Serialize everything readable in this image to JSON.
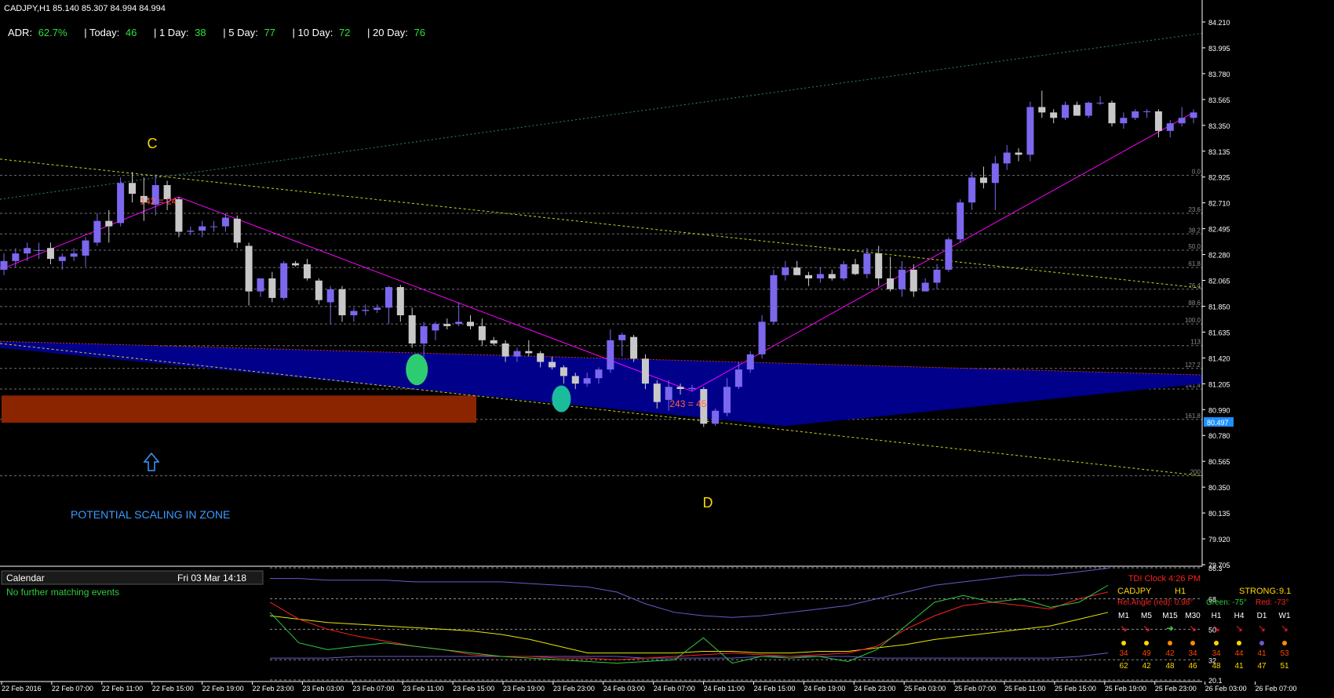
{
  "header": {
    "symbol_line": "CADJPY,H1  85.140 85.307 84.994 84.994"
  },
  "adr_bar": [
    {
      "label": "ADR:",
      "value": "62.7%"
    },
    {
      "label": "| Today:",
      "value": "46"
    },
    {
      "label": "| 1 Day:",
      "value": "38"
    },
    {
      "label": "| 5 Day:",
      "value": "77"
    },
    {
      "label": "| 10 Day:",
      "value": "72"
    },
    {
      "label": "| 20 Day:",
      "value": "76"
    }
  ],
  "annotations": {
    "point_c": "C",
    "point_d": "D",
    "swing_high": "142 = 24",
    "swing_low": "243 = 45",
    "zone_text": "POTENTIAL SCALING IN ZONE"
  },
  "colors": {
    "bull": "#7b68ee",
    "bear": "#c8c8c8",
    "pattern": "#ff00ff",
    "zone": "#00008b",
    "demand": "#8b2500",
    "trend_dotted": "#d2d21e",
    "green_dotted": "#2e8b57"
  },
  "chart_data": {
    "type": "candlestick",
    "symbol": "CADJPY",
    "timeframe": "H1",
    "ohlc_header": {
      "open": 85.14,
      "high": 85.307,
      "low": 84.994,
      "close": 84.994
    },
    "y_range": [
      79.6,
      84.3
    ],
    "y_ticks": [
      "84.210",
      "83.995",
      "83.780",
      "83.565",
      "83.350",
      "83.135",
      "82.925",
      "82.710",
      "82.495",
      "82.280",
      "82.065",
      "81.850",
      "81.635",
      "81.420",
      "81.205",
      "80.990",
      "80.780",
      "80.565",
      "80.350",
      "80.135",
      "79.920",
      "79.705"
    ],
    "current_price": "80.497",
    "x_ticks": [
      "22 Feb 2016",
      "22 Feb 07:00",
      "22 Feb 11:00",
      "22 Feb 15:00",
      "22 Feb 19:00",
      "22 Feb 23:00",
      "23 Feb 03:00",
      "23 Feb 07:00",
      "23 Feb 11:00",
      "23 Feb 15:00",
      "23 Feb 19:00",
      "23 Feb 23:00",
      "24 Feb 03:00",
      "24 Feb 07:00",
      "24 Feb 11:00",
      "24 Feb 15:00",
      "24 Feb 19:00",
      "24 Feb 23:00",
      "25 Feb 03:00",
      "25 Feb 07:00",
      "25 Feb 11:00",
      "25 Feb 15:00",
      "25 Feb 19:00",
      "25 Feb 23:00",
      "26 Feb 03:00",
      "26 Feb 07:00"
    ],
    "fib_levels": [
      {
        "label": "0.0",
        "price": 82.77
      },
      {
        "label": "23.6",
        "price": 82.42
      },
      {
        "label": "38.2",
        "price": 82.23
      },
      {
        "label": "50.0",
        "price": 82.08
      },
      {
        "label": "61.8",
        "price": 81.92
      },
      {
        "label": "76.4",
        "price": 81.72
      },
      {
        "label": "88.6",
        "price": 81.56
      },
      {
        "label": "100.0",
        "price": 81.4
      },
      {
        "label": "113",
        "price": 81.2
      },
      {
        "label": "127.2",
        "price": 80.99
      },
      {
        "label": "141.4",
        "price": 80.8
      },
      {
        "label": "161.8",
        "price": 80.52
      },
      {
        "label": "200",
        "price": 80.0
      }
    ],
    "candles": [
      {
        "o": 81.9,
        "h": 82.05,
        "l": 81.85,
        "c": 81.98
      },
      {
        "o": 81.98,
        "h": 82.1,
        "l": 81.92,
        "c": 82.05
      },
      {
        "o": 82.05,
        "h": 82.15,
        "l": 81.98,
        "c": 82.1
      },
      {
        "o": 82.08,
        "h": 82.15,
        "l": 82.0,
        "c": 82.08
      },
      {
        "o": 82.1,
        "h": 82.15,
        "l": 81.95,
        "c": 82.0
      },
      {
        "o": 81.98,
        "h": 82.05,
        "l": 81.9,
        "c": 82.02
      },
      {
        "o": 82.02,
        "h": 82.1,
        "l": 81.98,
        "c": 82.05
      },
      {
        "o": 82.03,
        "h": 82.2,
        "l": 81.93,
        "c": 82.17
      },
      {
        "o": 82.15,
        "h": 82.42,
        "l": 82.12,
        "c": 82.35
      },
      {
        "o": 82.35,
        "h": 82.45,
        "l": 82.15,
        "c": 82.3
      },
      {
        "o": 82.33,
        "h": 82.75,
        "l": 82.3,
        "c": 82.7
      },
      {
        "o": 82.7,
        "h": 82.8,
        "l": 82.52,
        "c": 82.6
      },
      {
        "o": 82.58,
        "h": 82.75,
        "l": 82.35,
        "c": 82.52
      },
      {
        "o": 82.5,
        "h": 82.78,
        "l": 82.4,
        "c": 82.68
      },
      {
        "o": 82.68,
        "h": 82.72,
        "l": 82.45,
        "c": 82.55
      },
      {
        "o": 82.55,
        "h": 82.57,
        "l": 82.2,
        "c": 82.25
      },
      {
        "o": 82.25,
        "h": 82.3,
        "l": 82.22,
        "c": 82.26
      },
      {
        "o": 82.26,
        "h": 82.35,
        "l": 82.2,
        "c": 82.3
      },
      {
        "o": 82.3,
        "h": 82.35,
        "l": 82.25,
        "c": 82.3
      },
      {
        "o": 82.3,
        "h": 82.42,
        "l": 82.25,
        "c": 82.38
      },
      {
        "o": 82.37,
        "h": 82.4,
        "l": 82.1,
        "c": 82.15
      },
      {
        "o": 82.12,
        "h": 82.15,
        "l": 81.57,
        "c": 81.7
      },
      {
        "o": 81.7,
        "h": 81.82,
        "l": 81.65,
        "c": 81.82
      },
      {
        "o": 81.82,
        "h": 81.88,
        "l": 81.6,
        "c": 81.64
      },
      {
        "o": 81.64,
        "h": 81.98,
        "l": 81.62,
        "c": 81.96
      },
      {
        "o": 81.96,
        "h": 81.98,
        "l": 81.93,
        "c": 81.94
      },
      {
        "o": 81.95,
        "h": 82.0,
        "l": 81.8,
        "c": 81.82
      },
      {
        "o": 81.8,
        "h": 81.82,
        "l": 81.58,
        "c": 81.62
      },
      {
        "o": 81.6,
        "h": 81.75,
        "l": 81.4,
        "c": 81.72
      },
      {
        "o": 81.72,
        "h": 81.75,
        "l": 81.42,
        "c": 81.48
      },
      {
        "o": 81.48,
        "h": 81.55,
        "l": 81.42,
        "c": 81.52
      },
      {
        "o": 81.52,
        "h": 81.58,
        "l": 81.48,
        "c": 81.53
      },
      {
        "o": 81.53,
        "h": 81.58,
        "l": 81.5,
        "c": 81.55
      },
      {
        "o": 81.55,
        "h": 81.75,
        "l": 81.4,
        "c": 81.74
      },
      {
        "o": 81.74,
        "h": 81.76,
        "l": 81.42,
        "c": 81.48
      },
      {
        "o": 81.48,
        "h": 81.55,
        "l": 81.18,
        "c": 81.22
      },
      {
        "o": 81.22,
        "h": 81.42,
        "l": 81.1,
        "c": 81.38
      },
      {
        "o": 81.34,
        "h": 81.42,
        "l": 81.25,
        "c": 81.4
      },
      {
        "o": 81.4,
        "h": 81.45,
        "l": 81.35,
        "c": 81.38
      },
      {
        "o": 81.4,
        "h": 81.6,
        "l": 81.38,
        "c": 81.42
      },
      {
        "o": 81.42,
        "h": 81.48,
        "l": 81.35,
        "c": 81.38
      },
      {
        "o": 81.38,
        "h": 81.45,
        "l": 81.2,
        "c": 81.25
      },
      {
        "o": 81.25,
        "h": 81.28,
        "l": 81.2,
        "c": 81.22
      },
      {
        "o": 81.22,
        "h": 81.25,
        "l": 81.05,
        "c": 81.1
      },
      {
        "o": 81.1,
        "h": 81.18,
        "l": 81.05,
        "c": 81.15
      },
      {
        "o": 81.15,
        "h": 81.25,
        "l": 81.1,
        "c": 81.13
      },
      {
        "o": 81.13,
        "h": 81.15,
        "l": 81.0,
        "c": 81.05
      },
      {
        "o": 81.05,
        "h": 81.1,
        "l": 80.98,
        "c": 81.0
      },
      {
        "o": 81.0,
        "h": 81.02,
        "l": 80.85,
        "c": 80.92
      },
      {
        "o": 80.92,
        "h": 80.95,
        "l": 80.8,
        "c": 80.85
      },
      {
        "o": 80.85,
        "h": 80.95,
        "l": 80.82,
        "c": 80.9
      },
      {
        "o": 80.9,
        "h": 81.0,
        "l": 80.85,
        "c": 80.98
      },
      {
        "o": 80.98,
        "h": 81.35,
        "l": 80.95,
        "c": 81.25
      },
      {
        "o": 81.25,
        "h": 81.32,
        "l": 81.1,
        "c": 81.3
      },
      {
        "o": 81.28,
        "h": 81.3,
        "l": 81.05,
        "c": 81.08
      },
      {
        "o": 81.08,
        "h": 81.12,
        "l": 80.8,
        "c": 80.85
      },
      {
        "o": 80.85,
        "h": 80.88,
        "l": 80.62,
        "c": 80.68
      },
      {
        "o": 80.7,
        "h": 80.88,
        "l": 80.6,
        "c": 80.82
      },
      {
        "o": 80.82,
        "h": 80.85,
        "l": 80.75,
        "c": 80.8
      },
      {
        "o": 80.8,
        "h": 80.84,
        "l": 80.78,
        "c": 80.81
      },
      {
        "o": 80.8,
        "h": 80.82,
        "l": 80.45,
        "c": 80.48
      },
      {
        "o": 80.48,
        "h": 80.62,
        "l": 80.46,
        "c": 80.6
      },
      {
        "o": 80.58,
        "h": 80.9,
        "l": 80.55,
        "c": 80.82
      },
      {
        "o": 80.82,
        "h": 81.05,
        "l": 80.8,
        "c": 80.98
      },
      {
        "o": 80.98,
        "h": 81.15,
        "l": 80.95,
        "c": 81.12
      },
      {
        "o": 81.12,
        "h": 81.48,
        "l": 81.08,
        "c": 81.42
      },
      {
        "o": 81.42,
        "h": 81.9,
        "l": 81.4,
        "c": 81.85
      },
      {
        "o": 81.85,
        "h": 81.98,
        "l": 81.8,
        "c": 81.92
      },
      {
        "o": 81.92,
        "h": 81.98,
        "l": 81.85,
        "c": 81.85
      },
      {
        "o": 81.85,
        "h": 81.88,
        "l": 81.75,
        "c": 81.82
      },
      {
        "o": 81.82,
        "h": 81.92,
        "l": 81.78,
        "c": 81.86
      },
      {
        "o": 81.86,
        "h": 81.9,
        "l": 81.8,
        "c": 81.82
      },
      {
        "o": 81.82,
        "h": 81.98,
        "l": 81.8,
        "c": 81.95
      },
      {
        "o": 81.95,
        "h": 82.0,
        "l": 81.85,
        "c": 81.86
      },
      {
        "o": 81.86,
        "h": 82.1,
        "l": 81.82,
        "c": 82.05
      },
      {
        "o": 82.05,
        "h": 82.12,
        "l": 81.75,
        "c": 81.82
      },
      {
        "o": 81.82,
        "h": 82.02,
        "l": 81.7,
        "c": 81.72
      },
      {
        "o": 81.72,
        "h": 81.98,
        "l": 81.65,
        "c": 81.9
      },
      {
        "o": 81.9,
        "h": 81.95,
        "l": 81.65,
        "c": 81.7
      },
      {
        "o": 81.7,
        "h": 81.82,
        "l": 81.7,
        "c": 81.78
      },
      {
        "o": 81.78,
        "h": 81.95,
        "l": 81.72,
        "c": 81.9
      },
      {
        "o": 81.9,
        "h": 82.2,
        "l": 81.88,
        "c": 82.18
      },
      {
        "o": 82.18,
        "h": 82.55,
        "l": 82.15,
        "c": 82.52
      },
      {
        "o": 82.52,
        "h": 82.8,
        "l": 82.45,
        "c": 82.75
      },
      {
        "o": 82.75,
        "h": 82.85,
        "l": 82.65,
        "c": 82.7
      },
      {
        "o": 82.7,
        "h": 82.95,
        "l": 82.45,
        "c": 82.88
      },
      {
        "o": 82.88,
        "h": 83.05,
        "l": 82.82,
        "c": 82.98
      },
      {
        "o": 82.98,
        "h": 83.02,
        "l": 82.9,
        "c": 82.96
      },
      {
        "o": 82.96,
        "h": 83.45,
        "l": 82.9,
        "c": 83.4
      },
      {
        "o": 83.4,
        "h": 83.55,
        "l": 83.3,
        "c": 83.35
      },
      {
        "o": 83.35,
        "h": 83.38,
        "l": 83.25,
        "c": 83.3
      },
      {
        "o": 83.3,
        "h": 83.45,
        "l": 83.28,
        "c": 83.42
      },
      {
        "o": 83.42,
        "h": 83.45,
        "l": 83.32,
        "c": 83.32
      },
      {
        "o": 83.32,
        "h": 83.45,
        "l": 83.3,
        "c": 83.44
      },
      {
        "o": 83.44,
        "h": 83.5,
        "l": 83.42,
        "c": 83.44
      },
      {
        "o": 83.44,
        "h": 83.46,
        "l": 83.22,
        "c": 83.25
      },
      {
        "o": 83.25,
        "h": 83.35,
        "l": 83.2,
        "c": 83.3
      },
      {
        "o": 83.3,
        "h": 83.38,
        "l": 83.28,
        "c": 83.36
      },
      {
        "o": 83.36,
        "h": 83.38,
        "l": 83.3,
        "c": 83.36
      },
      {
        "o": 83.36,
        "h": 83.38,
        "l": 83.12,
        "c": 83.18
      },
      {
        "o": 83.18,
        "h": 83.28,
        "l": 83.12,
        "c": 83.25
      },
      {
        "o": 83.25,
        "h": 83.4,
        "l": 83.22,
        "c": 83.3
      },
      {
        "o": 83.3,
        "h": 83.38,
        "l": 83.25,
        "c": 83.35
      }
    ]
  },
  "calendar": {
    "title": "Calendar",
    "datetime": "Fri 03 Mar 14:18",
    "message": "No further matching events"
  },
  "indicator": {
    "y_ticks": [
      "86.3",
      "68",
      "50",
      "32",
      "20.1"
    ],
    "tdi_title": "TDI Clock 4:26 PM",
    "symbol": "CADJPY",
    "timeframe": "H1",
    "strength": "STRONG:",
    "strength_val": "9.1",
    "rel_angle": "Rel.Angle (red): 0.98°",
    "green_angle": "Green: -75°",
    "red_angle": "Red: -73°",
    "tf_labels": [
      "M1",
      "M5",
      "M15",
      "M30",
      "H1",
      "H4",
      "D1",
      "W1"
    ],
    "row1": [
      "34",
      "49",
      "42",
      "34",
      "34",
      "44",
      "41",
      "53"
    ],
    "row2": [
      "62",
      "42",
      "48",
      "46",
      "48",
      "41",
      "47",
      "51"
    ]
  }
}
